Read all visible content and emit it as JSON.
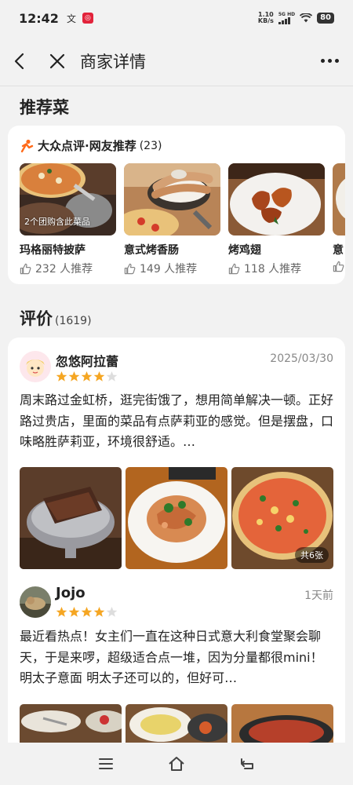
{
  "status_bar": {
    "time": "12:42",
    "wen_char": "文",
    "app_icon_char": "◎",
    "net_speed_top": "1.10",
    "net_speed_unit": "KB/s",
    "signal_label": "5G HD",
    "battery": "80"
  },
  "header": {
    "title": "商家详情"
  },
  "recommend": {
    "section_title": "推荐菜",
    "source_title": "大众点评·网友推荐",
    "source_count": "(23)",
    "dishes": [
      {
        "name": "玛格丽特披萨",
        "likes": "232 人推荐",
        "tag": "2个团购含此菜品"
      },
      {
        "name": "意式烤香肠",
        "likes": "149 人推荐",
        "tag": ""
      },
      {
        "name": "烤鸡翅",
        "likes": "118 人推荐",
        "tag": ""
      },
      {
        "name": "意",
        "likes": "",
        "tag": ""
      }
    ]
  },
  "reviews": {
    "section_title": "评价",
    "count": "(1619)",
    "items": [
      {
        "user": "忽悠阿拉蕾",
        "date": "2025/03/30",
        "rating": 4,
        "text": "周末路过金虹桥，逛完街饿了，想用简单解决一顿。正好路过贵店，里面的菜品有点萨莉亚的感觉。但是摆盘，口味略胜萨莉亚，环境很舒适。…",
        "photo_count_label": "共6张"
      },
      {
        "user": "Jojo",
        "date": "1天前",
        "rating": 4,
        "text": "最近看热点！女主们一直在这种日式意大利食堂聚会聊天，于是来啰，超级适合点一堆，因为分量都很mini！　明太子意面 明太子还可以的，但好可…",
        "photo_count_label": ""
      }
    ]
  },
  "colors": {
    "accent_orange": "#ff6a1a",
    "star_gold": "#f5a623",
    "star_empty": "#dddddd"
  }
}
